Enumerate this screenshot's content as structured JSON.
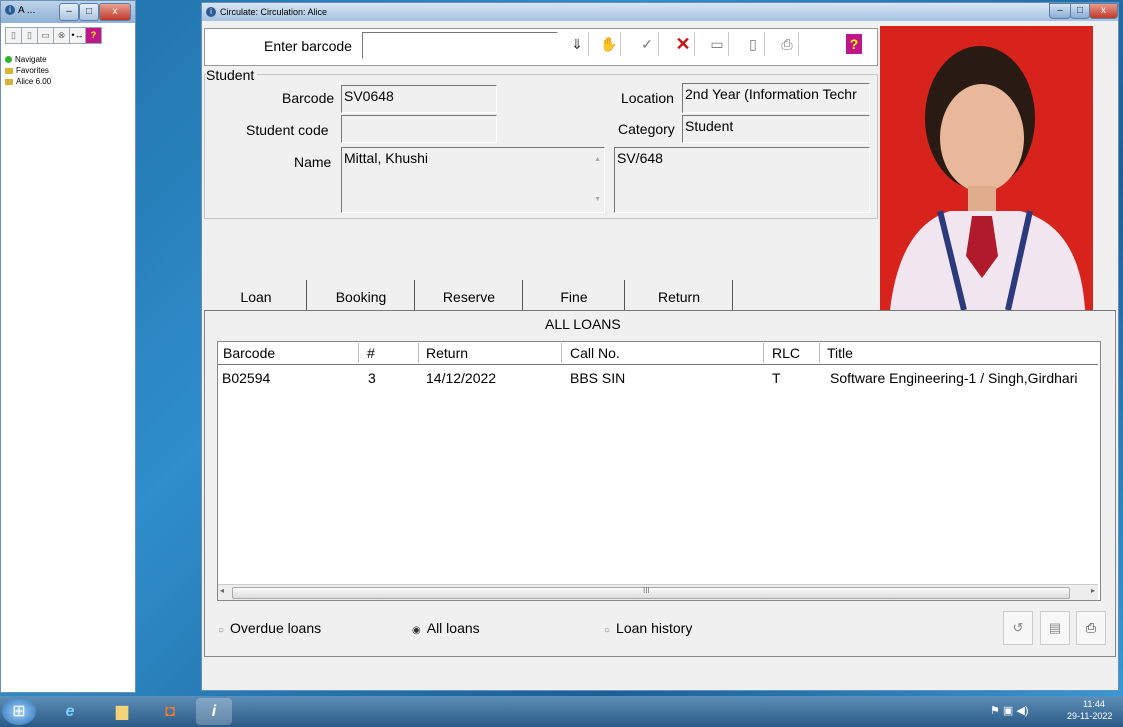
{
  "nav_window": {
    "title": "A ...",
    "tree": [
      {
        "label": "Navigate",
        "icon": "green-circle-icon"
      },
      {
        "label": "Favorites",
        "icon": "folder-icon"
      },
      {
        "label": "Alice 6.00",
        "icon": "folder-icon"
      }
    ]
  },
  "main_window": {
    "title": "Circulate: Circulation: Alice"
  },
  "barcode": {
    "label": "Enter barcode",
    "value": ""
  },
  "student": {
    "group_label": "Student",
    "barcode_label": "Barcode",
    "barcode_value": "SV0648",
    "code_label": "Student code",
    "code_value": "",
    "name_label": "Name",
    "name_value": "Mittal, Khushi",
    "location_label": "Location",
    "location_value": "2nd Year (Information Techr",
    "category_label": "Category",
    "category_value": "Student",
    "notes_value": "SV/648"
  },
  "tabs": [
    "Loan",
    "Booking",
    "Reserve",
    "Fine",
    "Return"
  ],
  "loans": {
    "heading": "ALL LOANS",
    "columns": [
      "Barcode",
      "#",
      "Return",
      "Call No.",
      "RLC",
      "Title"
    ],
    "rows": [
      [
        "B02594",
        "3",
        "14/12/2022",
        "BBS SIN",
        "T",
        "Software Engineering-1 / Singh,Girdhari"
      ]
    ]
  },
  "scroll_thumb_glyph": "III",
  "options": {
    "overdue": "Overdue loans",
    "all": "All loans",
    "history": "Loan history",
    "selected": "all"
  },
  "tray": {
    "time": "11:44",
    "date": "29-11-2022"
  },
  "colors": {
    "photo_bg": "#d8221c",
    "delete_red": "#cc1111",
    "help_magenta": "#c0168c"
  }
}
